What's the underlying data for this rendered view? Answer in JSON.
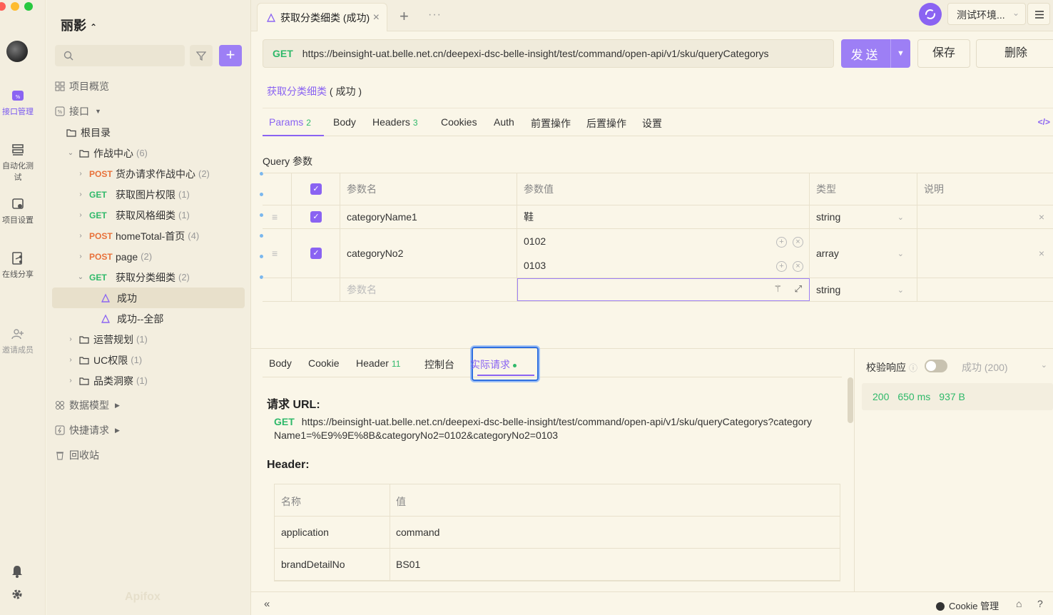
{
  "rail": {
    "items": [
      {
        "label": "接口管理",
        "icon": "api-icon"
      },
      {
        "label": "自动化测试",
        "icon": "automation-icon"
      },
      {
        "label": "项目设置",
        "icon": "project-settings-icon"
      },
      {
        "label": "在线分享",
        "icon": "share-icon"
      },
      {
        "label": "邀请成员",
        "icon": "invite-icon"
      }
    ]
  },
  "sidebar": {
    "project_name": "丽影",
    "nav": {
      "overview": "项目概览",
      "apis": "接口",
      "data_models": "数据模型",
      "quick_requests": "快捷请求",
      "recycle_bin": "回收站"
    },
    "tree": {
      "root": "根目录",
      "folder1": {
        "name": "作战中心",
        "count": "(6)"
      },
      "items": [
        {
          "method": "POST",
          "name": "货办请求作战中心",
          "count": "(2)"
        },
        {
          "method": "GET",
          "name": "获取图片权限",
          "count": "(1)"
        },
        {
          "method": "GET",
          "name": "获取风格细类",
          "count": "(1)"
        },
        {
          "method": "POST",
          "name": "homeTotal-首页",
          "count": "(4)"
        },
        {
          "method": "POST",
          "name": "page",
          "count": "(2)"
        },
        {
          "method": "GET",
          "name": "获取分类细类",
          "count": "(2)"
        }
      ],
      "cases": [
        "成功",
        "成功--全部"
      ],
      "folders": [
        {
          "name": "运营规划",
          "count": "(1)"
        },
        {
          "name": "UC权限",
          "count": "(1)"
        },
        {
          "name": "品类洞察",
          "count": "(1)"
        }
      ]
    },
    "watermark": "Apifox"
  },
  "tabs": {
    "active": "获取分类细类 (成功)"
  },
  "env": {
    "name": "测试环境..."
  },
  "request": {
    "method": "GET",
    "url": "https://beinsight-uat.belle.net.cn/deepexi-dsc-belle-insight/test/command/open-api/v1/sku/queryCategorys",
    "send": "发送",
    "save": "保存",
    "delete": "删除",
    "crumb_link": "获取分类细类",
    "crumb_case": "( 成功 )"
  },
  "req_tabs": [
    {
      "label": "Params",
      "badge": "2"
    },
    {
      "label": "Body",
      "badge": ""
    },
    {
      "label": "Headers",
      "badge": "3"
    },
    {
      "label": "Cookies",
      "badge": ""
    },
    {
      "label": "Auth",
      "badge": ""
    },
    {
      "label": "前置操作",
      "badge": ""
    },
    {
      "label": "后置操作",
      "badge": ""
    },
    {
      "label": "设置",
      "badge": ""
    }
  ],
  "query": {
    "label": "Query 参数",
    "headers": {
      "name": "参数名",
      "value": "参数值",
      "type": "类型",
      "desc": "说明"
    },
    "rows": [
      {
        "name": "categoryName1",
        "values": [
          "鞋"
        ],
        "type": "string"
      },
      {
        "name": "categoryNo2",
        "values": [
          "0102",
          "0103"
        ],
        "type": "array"
      }
    ],
    "new_row": {
      "name_placeholder": "参数名",
      "type": "string"
    }
  },
  "response": {
    "tabs": [
      {
        "label": "Body",
        "badge": ""
      },
      {
        "label": "Cookie",
        "badge": ""
      },
      {
        "label": "Header",
        "badge": "11"
      },
      {
        "label": "控制台",
        "badge": ""
      },
      {
        "label": "实际请求",
        "badge": ""
      }
    ],
    "url_title": "请求 URL:",
    "url_method": "GET",
    "url_full": "https://beinsight-uat.belle.net.cn/deepexi-dsc-belle-insight/test/command/open-api/v1/sku/queryCategorys?categoryName1=%E9%9E%8B&categoryNo2=0102&categoryNo2=0103",
    "header_title": "Header:",
    "header_cols": {
      "name": "名称",
      "value": "值"
    },
    "header_rows": [
      {
        "name": "application",
        "value": "command"
      },
      {
        "name": "brandDetailNo",
        "value": "BS01"
      }
    ]
  },
  "verify": {
    "label": "校验响应",
    "status": "成功 (200)",
    "code": "200",
    "time": "650 ms",
    "size": "937 B"
  },
  "statusbar": {
    "cookie": "Cookie 管理"
  },
  "colors": {
    "accent": "#8a63f2",
    "get": "#2fb96a",
    "post": "#e8713a"
  }
}
